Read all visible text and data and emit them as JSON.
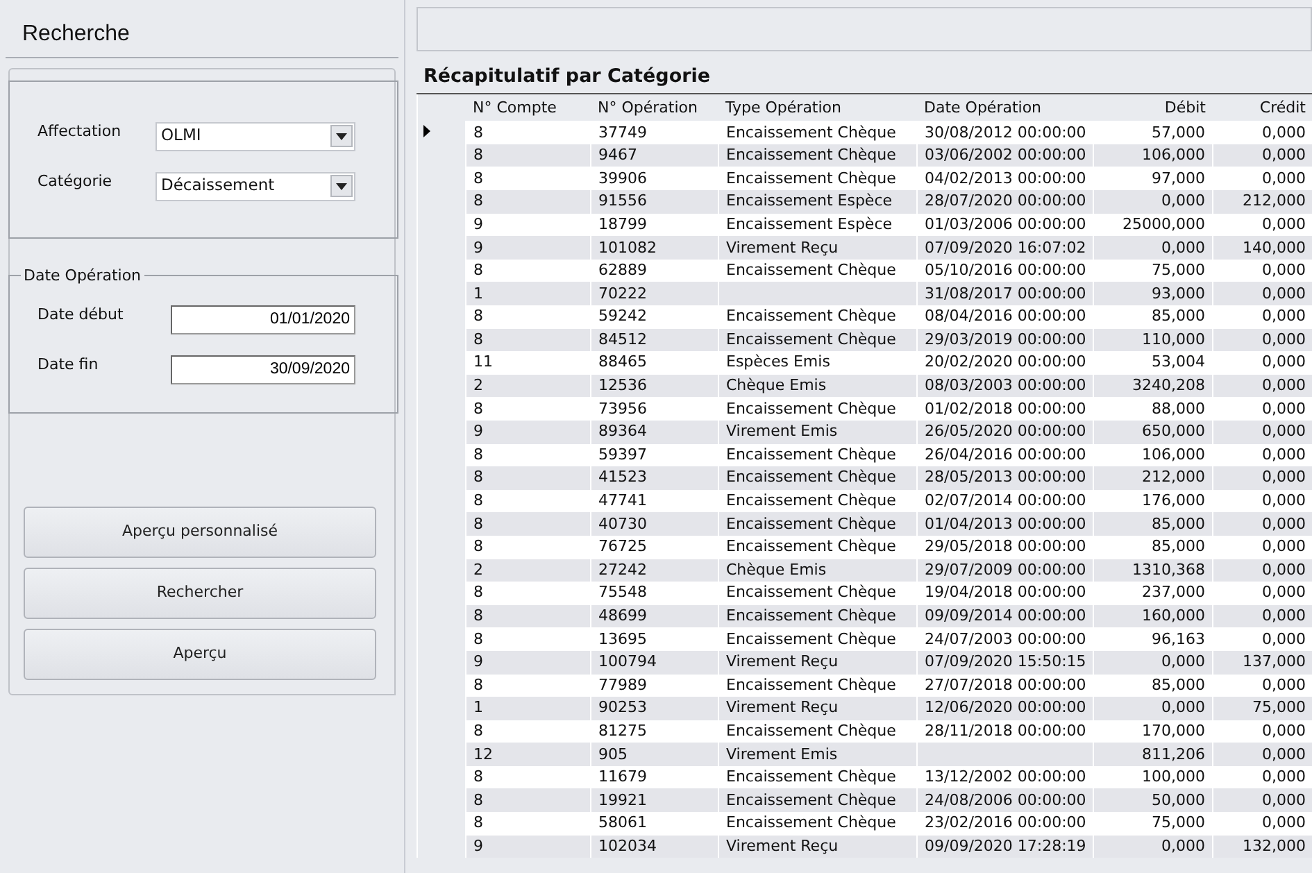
{
  "search_panel": {
    "title": "Recherche",
    "filters": [
      {
        "label": "Affectation",
        "value": "OLMI"
      },
      {
        "label": "Catégorie",
        "value": "Décaissement"
      }
    ],
    "date_group": {
      "legend": "Date Opération",
      "fields": [
        {
          "label": "Date début",
          "value": "01/01/2020"
        },
        {
          "label": "Date fin",
          "value": "30/09/2020"
        }
      ]
    },
    "buttons": [
      "Aperçu personnalisé",
      "Rechercher",
      "Aperçu"
    ]
  },
  "table": {
    "title": "Récapitulatif par Catégorie",
    "columns": [
      "N° Compte",
      "N° Opération",
      "Type Opération",
      "Date Opération",
      "Débit",
      "Crédit"
    ],
    "rows": [
      {
        "selected": true,
        "cells": [
          "8",
          "37749",
          "Encaissement Chèque",
          "30/08/2012 00:00:00",
          "57,000",
          "0,000"
        ]
      },
      {
        "selected": false,
        "cells": [
          "8",
          "9467",
          "Encaissement Chèque",
          "03/06/2002 00:00:00",
          "106,000",
          "0,000"
        ]
      },
      {
        "selected": false,
        "cells": [
          "8",
          "39906",
          "Encaissement Chèque",
          "04/02/2013 00:00:00",
          "97,000",
          "0,000"
        ]
      },
      {
        "selected": false,
        "cells": [
          "8",
          "91556",
          "Encaissement Espèce",
          "28/07/2020 00:00:00",
          "0,000",
          "212,000"
        ]
      },
      {
        "selected": false,
        "cells": [
          "9",
          "18799",
          "Encaissement Espèce",
          "01/03/2006 00:00:00",
          "25000,000",
          "0,000"
        ]
      },
      {
        "selected": false,
        "cells": [
          "9",
          "101082",
          "Virement Reçu",
          "07/09/2020 16:07:02",
          "0,000",
          "140,000"
        ]
      },
      {
        "selected": false,
        "cells": [
          "8",
          "62889",
          "Encaissement Chèque",
          "05/10/2016 00:00:00",
          "75,000",
          "0,000"
        ]
      },
      {
        "selected": false,
        "cells": [
          "1",
          "70222",
          "",
          "31/08/2017 00:00:00",
          "93,000",
          "0,000"
        ]
      },
      {
        "selected": false,
        "cells": [
          "8",
          "59242",
          "Encaissement Chèque",
          "08/04/2016 00:00:00",
          "85,000",
          "0,000"
        ]
      },
      {
        "selected": false,
        "cells": [
          "8",
          "84512",
          "Encaissement Chèque",
          "29/03/2019 00:00:00",
          "110,000",
          "0,000"
        ]
      },
      {
        "selected": false,
        "cells": [
          "11",
          "88465",
          "Espèces Emis",
          "20/02/2020 00:00:00",
          "53,004",
          "0,000"
        ]
      },
      {
        "selected": false,
        "cells": [
          "2",
          "12536",
          "Chèque Emis",
          "08/03/2003 00:00:00",
          "3240,208",
          "0,000"
        ]
      },
      {
        "selected": false,
        "cells": [
          "8",
          "73956",
          "Encaissement Chèque",
          "01/02/2018 00:00:00",
          "88,000",
          "0,000"
        ]
      },
      {
        "selected": false,
        "cells": [
          "9",
          "89364",
          "Virement Emis",
          "26/05/2020 00:00:00",
          "650,000",
          "0,000"
        ]
      },
      {
        "selected": false,
        "cells": [
          "8",
          "59397",
          "Encaissement Chèque",
          "26/04/2016 00:00:00",
          "106,000",
          "0,000"
        ]
      },
      {
        "selected": false,
        "cells": [
          "8",
          "41523",
          "Encaissement Chèque",
          "28/05/2013 00:00:00",
          "212,000",
          "0,000"
        ]
      },
      {
        "selected": false,
        "cells": [
          "8",
          "47741",
          "Encaissement Chèque",
          "02/07/2014 00:00:00",
          "176,000",
          "0,000"
        ]
      },
      {
        "selected": false,
        "cells": [
          "8",
          "40730",
          "Encaissement Chèque",
          "01/04/2013 00:00:00",
          "85,000",
          "0,000"
        ]
      },
      {
        "selected": false,
        "cells": [
          "8",
          "76725",
          "Encaissement Chèque",
          "29/05/2018 00:00:00",
          "85,000",
          "0,000"
        ]
      },
      {
        "selected": false,
        "cells": [
          "2",
          "27242",
          "Chèque Emis",
          "29/07/2009 00:00:00",
          "1310,368",
          "0,000"
        ]
      },
      {
        "selected": false,
        "cells": [
          "8",
          "75548",
          "Encaissement Chèque",
          "19/04/2018 00:00:00",
          "237,000",
          "0,000"
        ]
      },
      {
        "selected": false,
        "cells": [
          "8",
          "48699",
          "Encaissement Chèque",
          "09/09/2014 00:00:00",
          "160,000",
          "0,000"
        ]
      },
      {
        "selected": false,
        "cells": [
          "8",
          "13695",
          "Encaissement Chèque",
          "24/07/2003 00:00:00",
          "96,163",
          "0,000"
        ]
      },
      {
        "selected": false,
        "cells": [
          "9",
          "100794",
          "Virement Reçu",
          "07/09/2020 15:50:15",
          "0,000",
          "137,000"
        ]
      },
      {
        "selected": false,
        "cells": [
          "8",
          "77989",
          "Encaissement Chèque",
          "27/07/2018 00:00:00",
          "85,000",
          "0,000"
        ]
      },
      {
        "selected": false,
        "cells": [
          "1",
          "90253",
          "Virement Reçu",
          "12/06/2020 00:00:00",
          "0,000",
          "75,000"
        ]
      },
      {
        "selected": false,
        "cells": [
          "8",
          "81275",
          "Encaissement Chèque",
          "28/11/2018 00:00:00",
          "170,000",
          "0,000"
        ]
      },
      {
        "selected": false,
        "cells": [
          "12",
          "905",
          "Virement Emis",
          "",
          "811,206",
          "0,000"
        ]
      },
      {
        "selected": false,
        "cells": [
          "8",
          "11679",
          "Encaissement Chèque",
          "13/12/2002 00:00:00",
          "100,000",
          "0,000"
        ]
      },
      {
        "selected": false,
        "cells": [
          "8",
          "19921",
          "Encaissement Chèque",
          "24/08/2006 00:00:00",
          "50,000",
          "0,000"
        ]
      },
      {
        "selected": false,
        "cells": [
          "8",
          "58061",
          "Encaissement Chèque",
          "23/02/2016 00:00:00",
          "75,000",
          "0,000"
        ]
      },
      {
        "selected": false,
        "cells": [
          "9",
          "102034",
          "Virement Reçu",
          "09/09/2020 17:28:19",
          "0,000",
          "132,000"
        ]
      }
    ]
  }
}
